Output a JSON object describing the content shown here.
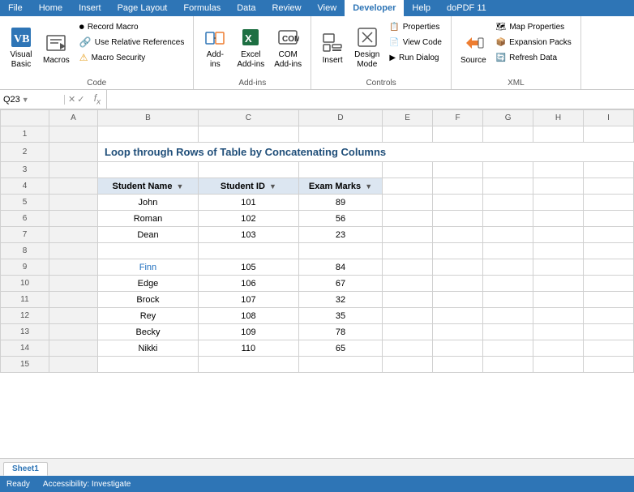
{
  "ribbon": {
    "tabs": [
      "File",
      "Home",
      "Insert",
      "Page Layout",
      "Formulas",
      "Data",
      "Review",
      "View",
      "Developer",
      "Help",
      "doPDF 11"
    ],
    "active_tab": "Developer",
    "groups": {
      "code": {
        "label": "Code",
        "visual_basic_label": "Visual\nBasic",
        "macros_label": "Macros",
        "record_macro_label": "Record Macro",
        "relative_refs_label": "Use Relative References",
        "macro_security_label": "Macro Security"
      },
      "addins": {
        "label": "Add-ins",
        "addins_label": "Add-\nins",
        "excel_addins_label": "Excel\nAdd-ins",
        "com_addins_label": "COM\nAdd-ins"
      },
      "controls": {
        "label": "Controls",
        "insert_label": "Insert",
        "design_mode_label": "Design\nMode",
        "properties_label": "Properties",
        "view_code_label": "View Code",
        "run_dialog_label": "Run Dialog"
      },
      "xml": {
        "label": "XML",
        "source_label": "Source",
        "map_properties_label": "Map Properties",
        "expansion_packs_label": "Expansion Packs",
        "refresh_data_label": "Refresh Data"
      }
    }
  },
  "formula_bar": {
    "cell_ref": "Q23",
    "formula_placeholder": ""
  },
  "spreadsheet": {
    "title": "Loop through Rows of Table by Concatenating Columns",
    "columns": [
      "A",
      "B",
      "C",
      "D",
      "E",
      "F",
      "G",
      "H",
      "I"
    ],
    "rows": [
      1,
      2,
      3,
      4,
      5,
      6,
      7,
      8,
      9,
      10,
      11,
      12,
      13,
      14,
      15
    ],
    "table_headers": [
      "Student Name",
      "Student ID",
      "Exam Marks"
    ],
    "table_data": [
      {
        "name": "John",
        "id": "101",
        "marks": "89"
      },
      {
        "name": "Roman",
        "id": "102",
        "marks": "56"
      },
      {
        "name": "Dean",
        "id": "103",
        "marks": "23"
      },
      {
        "name": "",
        "id": "",
        "marks": ""
      },
      {
        "name": "Finn",
        "id": "105",
        "marks": "84"
      },
      {
        "name": "Edge",
        "id": "106",
        "marks": "67"
      },
      {
        "name": "Brock",
        "id": "107",
        "marks": "32"
      },
      {
        "name": "Rey",
        "id": "108",
        "marks": "35"
      },
      {
        "name": "Becky",
        "id": "109",
        "marks": "78"
      },
      {
        "name": "Nikki",
        "id": "110",
        "marks": "65"
      }
    ],
    "sheet_tab": "Sheet1"
  },
  "status_bar": {
    "items": [
      "Ready",
      "Accessibility: Investigate"
    ]
  },
  "colors": {
    "ribbon_bg": "#2e75b6",
    "active_tab_bg": "#ffffff",
    "title_color": "#1f4e79",
    "table_header_bg": "#dce6f1",
    "blue_data_color": "#1f6fbf"
  }
}
